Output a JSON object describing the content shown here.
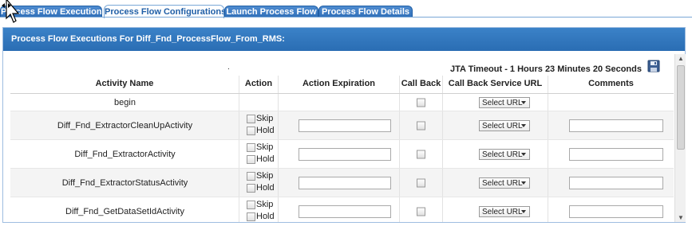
{
  "tabs": [
    {
      "label": "Process Flow Executions",
      "active": false
    },
    {
      "label": "Process Flow Configurations",
      "active": true
    },
    {
      "label": "Launch Process Flow",
      "active": false
    },
    {
      "label": "Process Flow Details",
      "active": false
    }
  ],
  "panel": {
    "title": "Process Flow Executions For Diff_Fnd_ProcessFlow_From_RMS:",
    "dot": ".",
    "timeout": "JTA Timeout - 1 Hours 23 Minutes 20 Seconds"
  },
  "table": {
    "headers": [
      "Activity Name",
      "Action",
      "Action Expiration",
      "Call Back",
      "Call Back Service URL",
      "Comments"
    ],
    "skip_label": "Skip",
    "hold_label": "Hold",
    "select_label": "Select URL",
    "rows": [
      {
        "name": "begin"
      },
      {
        "name": "Diff_Fnd_ExtractorCleanUpActivity"
      },
      {
        "name": "Diff_Fnd_ExtractorActivity"
      },
      {
        "name": "Diff_Fnd_ExtractorStatusActivity"
      },
      {
        "name": "Diff_Fnd_GetDataSetIdActivity"
      }
    ]
  },
  "colors": {
    "accent": "#2f6eb8",
    "header": "#3b82c8"
  }
}
